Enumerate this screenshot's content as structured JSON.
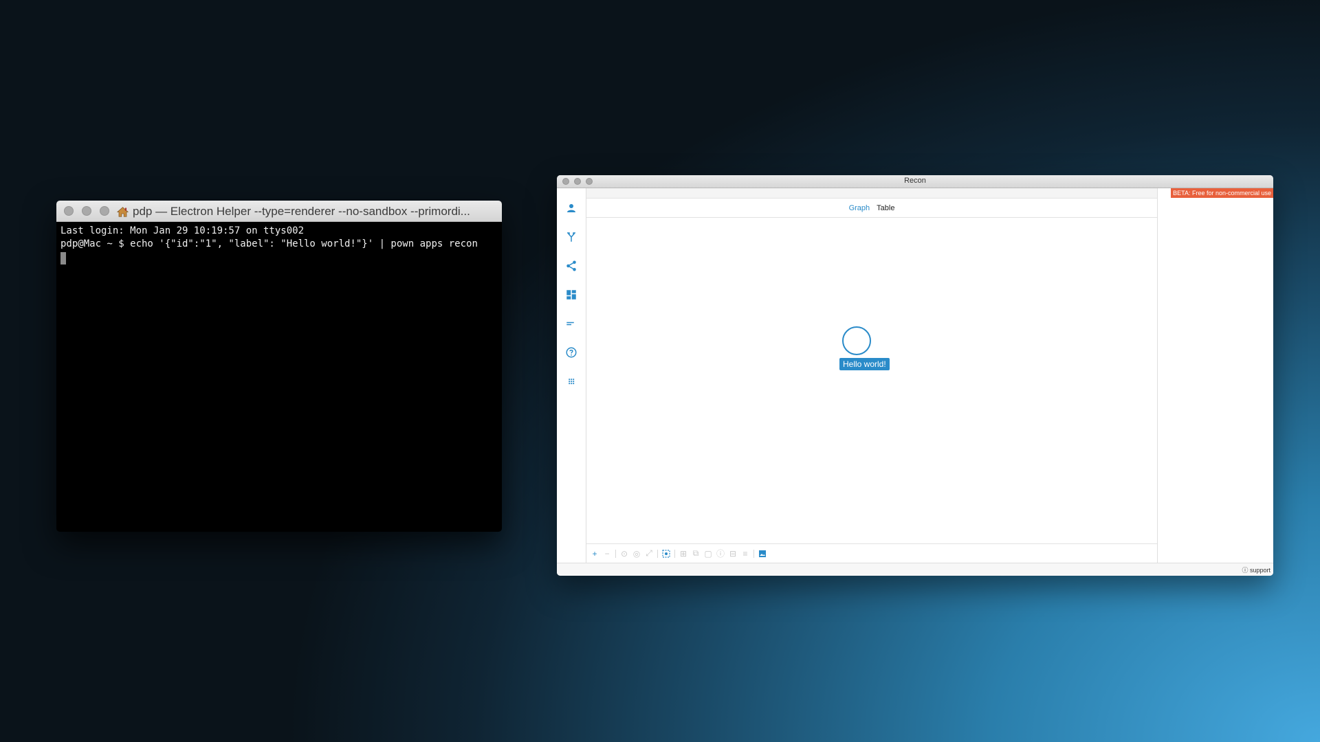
{
  "terminal": {
    "title": "pdp — Electron Helper --type=renderer --no-sandbox --primordi...",
    "lines": [
      "Last login: Mon Jan 29 10:19:57 on ttys002",
      "pdp@Mac ~ $ echo '{\"id\":\"1\", \"label\": \"Hello world!\"}' | pown apps recon"
    ]
  },
  "recon": {
    "title": "Recon",
    "beta_badge": "BETA: Free for non-commercial use",
    "tabs": [
      {
        "label": "Graph",
        "active": true
      },
      {
        "label": "Table",
        "active": false
      }
    ],
    "sidebar_icons": [
      "person-icon",
      "merge-icon",
      "share-icon",
      "dashboard-icon",
      "sort-icon",
      "help-icon",
      "apps-icon"
    ],
    "node": {
      "label": "Hello world!"
    },
    "toolbar": {
      "add": "+",
      "remove": "−"
    },
    "support_label": "support",
    "accent_color": "#2a8bc9",
    "badge_color": "#e8603c"
  }
}
